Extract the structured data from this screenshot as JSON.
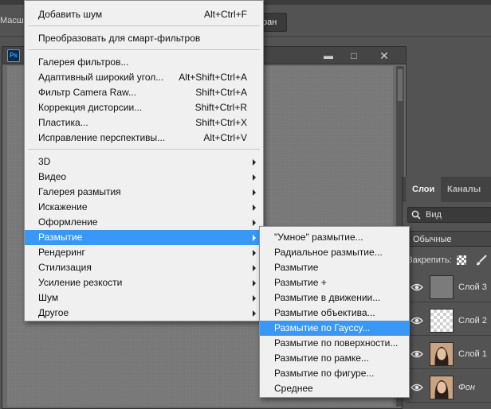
{
  "colors": {
    "accent": "#3998f5",
    "menu_bg": "#f0f0f0",
    "workspace": "#535353"
  },
  "toolbar": {
    "option_label": "Масшт",
    "button_label": "ран"
  },
  "filter_menu": {
    "items_group1": [
      {
        "label": "Добавить шум",
        "shortcut": "Alt+Ctrl+F"
      }
    ],
    "items_group2": [
      {
        "label": "Преобразовать для смарт-фильтров"
      }
    ],
    "items_group3": [
      {
        "label": "Галерея фильтров...",
        "shortcut": ""
      },
      {
        "label": "Адаптивный широкий угол...",
        "shortcut": "Alt+Shift+Ctrl+A"
      },
      {
        "label": "Фильтр Camera Raw...",
        "shortcut": "Shift+Ctrl+A"
      },
      {
        "label": "Коррекция дисторсии...",
        "shortcut": "Shift+Ctrl+R"
      },
      {
        "label": "Пластика...",
        "shortcut": "Shift+Ctrl+X"
      },
      {
        "label": "Исправление перспективы...",
        "shortcut": "Alt+Ctrl+V"
      }
    ],
    "submenus": [
      {
        "label": "3D"
      },
      {
        "label": "Видео"
      },
      {
        "label": "Галерея размытия"
      },
      {
        "label": "Искажение"
      },
      {
        "label": "Оформление"
      },
      {
        "label": "Размытие"
      },
      {
        "label": "Рендеринг"
      },
      {
        "label": "Стилизация"
      },
      {
        "label": "Усиление резкости"
      },
      {
        "label": "Шум"
      },
      {
        "label": "Другое"
      }
    ],
    "highlighted": "Размытие"
  },
  "blur_submenu": {
    "items": [
      {
        "label": "\"Умное\" размытие..."
      },
      {
        "label": "Радиальное размытие..."
      },
      {
        "label": "Размытие"
      },
      {
        "label": "Размытие +"
      },
      {
        "label": "Размытие в движении..."
      },
      {
        "label": "Размытие объектива..."
      },
      {
        "label": "Размытие по Гауссу..."
      },
      {
        "label": "Размытие по поверхности..."
      },
      {
        "label": "Размытие по рамке..."
      },
      {
        "label": "Размытие по фигуре..."
      },
      {
        "label": "Среднее"
      }
    ],
    "highlighted": "Размытие по Гауссу..."
  },
  "layers_panel": {
    "tabs": [
      "Слои",
      "Каналы"
    ],
    "search_placeholder": "Вид",
    "blend_mode": "Обычные",
    "lock_label": "Закрепить:",
    "layers": [
      {
        "name": "Слой 3",
        "thumb": "gray"
      },
      {
        "name": "Слой 2",
        "thumb": "transparent"
      },
      {
        "name": "Слой 1",
        "thumb": "photo"
      },
      {
        "name": "Фон",
        "thumb": "photo"
      }
    ]
  },
  "icons": {
    "app": "photoshop-logo-icon",
    "eye": "eye-icon",
    "search": "search-icon"
  }
}
